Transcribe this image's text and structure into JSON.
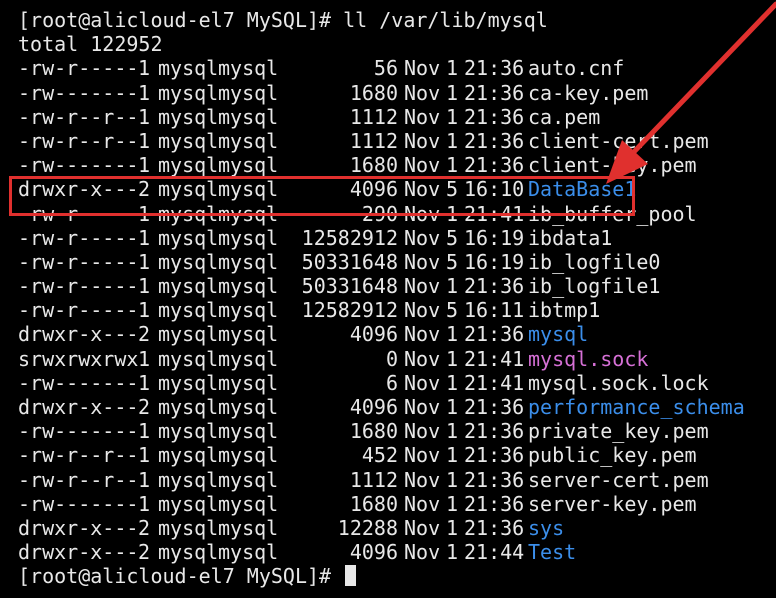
{
  "terminal": {
    "prompt_line": "[root@alicloud-el7 MySQL]# ll /var/lib/mysql",
    "total_line": "total 122952",
    "entries": [
      {
        "perm": "-rw-r-----",
        "links": "1",
        "owner": "mysql",
        "group": "mysql",
        "size": "56",
        "month": "Nov",
        "day": "1",
        "time": "21:36",
        "name": "auto.cnf",
        "kind": "file"
      },
      {
        "perm": "-rw-------",
        "links": "1",
        "owner": "mysql",
        "group": "mysql",
        "size": "1680",
        "month": "Nov",
        "day": "1",
        "time": "21:36",
        "name": "ca-key.pem",
        "kind": "file"
      },
      {
        "perm": "-rw-r--r--",
        "links": "1",
        "owner": "mysql",
        "group": "mysql",
        "size": "1112",
        "month": "Nov",
        "day": "1",
        "time": "21:36",
        "name": "ca.pem",
        "kind": "file"
      },
      {
        "perm": "-rw-r--r--",
        "links": "1",
        "owner": "mysql",
        "group": "mysql",
        "size": "1112",
        "month": "Nov",
        "day": "1",
        "time": "21:36",
        "name": "client-cert.pem",
        "kind": "file"
      },
      {
        "perm": "-rw-------",
        "links": "1",
        "owner": "mysql",
        "group": "mysql",
        "size": "1680",
        "month": "Nov",
        "day": "1",
        "time": "21:36",
        "name": "client-key.pem",
        "kind": "file"
      },
      {
        "perm": "drwxr-x---",
        "links": "2",
        "owner": "mysql",
        "group": "mysql",
        "size": "4096",
        "month": "Nov",
        "day": "5",
        "time": "16:10",
        "name": "DataBase1",
        "kind": "dir"
      },
      {
        "perm": "-rw-r-----",
        "links": "1",
        "owner": "mysql",
        "group": "mysql",
        "size": "290",
        "month": "Nov",
        "day": "1",
        "time": "21:41",
        "name": "ib_buffer_pool",
        "kind": "file"
      },
      {
        "perm": "-rw-r-----",
        "links": "1",
        "owner": "mysql",
        "group": "mysql",
        "size": "12582912",
        "month": "Nov",
        "day": "5",
        "time": "16:19",
        "name": "ibdata1",
        "kind": "file"
      },
      {
        "perm": "-rw-r-----",
        "links": "1",
        "owner": "mysql",
        "group": "mysql",
        "size": "50331648",
        "month": "Nov",
        "day": "5",
        "time": "16:19",
        "name": "ib_logfile0",
        "kind": "file"
      },
      {
        "perm": "-rw-r-----",
        "links": "1",
        "owner": "mysql",
        "group": "mysql",
        "size": "50331648",
        "month": "Nov",
        "day": "1",
        "time": "21:36",
        "name": "ib_logfile1",
        "kind": "file"
      },
      {
        "perm": "-rw-r-----",
        "links": "1",
        "owner": "mysql",
        "group": "mysql",
        "size": "12582912",
        "month": "Nov",
        "day": "5",
        "time": "16:11",
        "name": "ibtmp1",
        "kind": "file"
      },
      {
        "perm": "drwxr-x---",
        "links": "2",
        "owner": "mysql",
        "group": "mysql",
        "size": "4096",
        "month": "Nov",
        "day": "1",
        "time": "21:36",
        "name": "mysql",
        "kind": "dir"
      },
      {
        "perm": "srwxrwxrwx",
        "links": "1",
        "owner": "mysql",
        "group": "mysql",
        "size": "0",
        "month": "Nov",
        "day": "1",
        "time": "21:41",
        "name": "mysql.sock",
        "kind": "socket"
      },
      {
        "perm": "-rw-------",
        "links": "1",
        "owner": "mysql",
        "group": "mysql",
        "size": "6",
        "month": "Nov",
        "day": "1",
        "time": "21:41",
        "name": "mysql.sock.lock",
        "kind": "file"
      },
      {
        "perm": "drwxr-x---",
        "links": "2",
        "owner": "mysql",
        "group": "mysql",
        "size": "4096",
        "month": "Nov",
        "day": "1",
        "time": "21:36",
        "name": "performance_schema",
        "kind": "dir"
      },
      {
        "perm": "-rw-------",
        "links": "1",
        "owner": "mysql",
        "group": "mysql",
        "size": "1680",
        "month": "Nov",
        "day": "1",
        "time": "21:36",
        "name": "private_key.pem",
        "kind": "file"
      },
      {
        "perm": "-rw-r--r--",
        "links": "1",
        "owner": "mysql",
        "group": "mysql",
        "size": "452",
        "month": "Nov",
        "day": "1",
        "time": "21:36",
        "name": "public_key.pem",
        "kind": "file"
      },
      {
        "perm": "-rw-r--r--",
        "links": "1",
        "owner": "mysql",
        "group": "mysql",
        "size": "1112",
        "month": "Nov",
        "day": "1",
        "time": "21:36",
        "name": "server-cert.pem",
        "kind": "file"
      },
      {
        "perm": "-rw-------",
        "links": "1",
        "owner": "mysql",
        "group": "mysql",
        "size": "1680",
        "month": "Nov",
        "day": "1",
        "time": "21:36",
        "name": "server-key.pem",
        "kind": "file"
      },
      {
        "perm": "drwxr-x---",
        "links": "2",
        "owner": "mysql",
        "group": "mysql",
        "size": "12288",
        "month": "Nov",
        "day": "1",
        "time": "21:36",
        "name": "sys",
        "kind": "dir"
      },
      {
        "perm": "drwxr-x---",
        "links": "2",
        "owner": "mysql",
        "group": "mysql",
        "size": "4096",
        "month": "Nov",
        "day": "1",
        "time": "21:44",
        "name": "Test",
        "kind": "dir"
      }
    ],
    "final_prompt": "[root@alicloud-el7 MySQL]# ",
    "colors": {
      "background": "#000000",
      "text": "#e8e8e8",
      "directory": "#3b8eea",
      "socket": "#d670d6",
      "annotation": "#e0302e"
    }
  },
  "annotation": {
    "highlighted_entry": "DataBase1",
    "arrow_icon": "red-arrow-icon"
  }
}
